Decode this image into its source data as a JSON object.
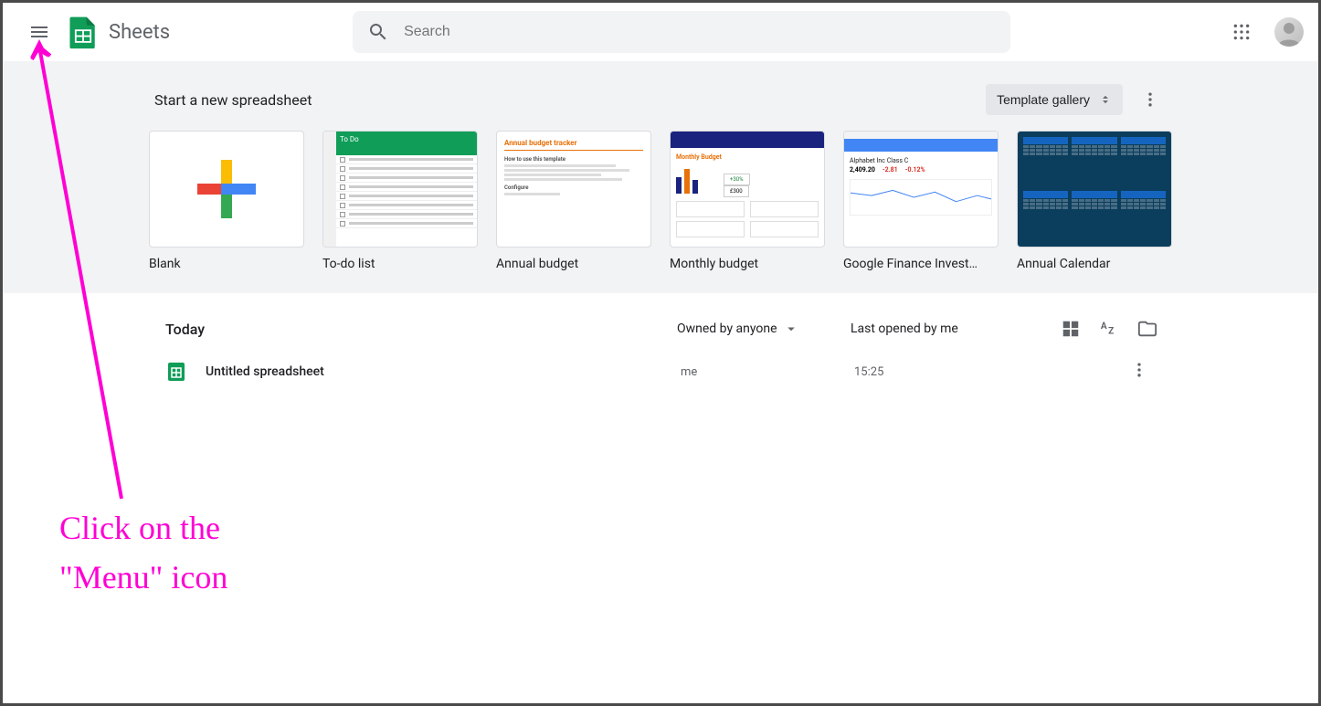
{
  "header": {
    "app_title": "Sheets",
    "search_placeholder": "Search"
  },
  "templates": {
    "section_title": "Start a new spreadsheet",
    "gallery_button": "Template gallery",
    "items": [
      {
        "label": "Blank"
      },
      {
        "label": "To-do list"
      },
      {
        "label": "Annual budget"
      },
      {
        "label": "Monthly budget"
      },
      {
        "label": "Google Finance Invest…"
      },
      {
        "label": "Annual Calendar"
      }
    ],
    "thumb_todo_header": "To Do",
    "thumb_annual_title": "Annual budget tracker",
    "thumb_annual_sub1": "How to use this template",
    "thumb_annual_sub2": "Configure",
    "thumb_monthly_title": "Monthly Budget",
    "thumb_monthly_stat_pct": "+30%",
    "thumb_monthly_stat_val": "£300",
    "thumb_finance_name": "Alphabet Inc Class C",
    "thumb_finance_price": "2,409.20",
    "thumb_finance_change1": "-2.81",
    "thumb_finance_change2": "-0.12%"
  },
  "files": {
    "section_title": "Today",
    "owner_filter": "Owned by anyone",
    "sort_label": "Last opened by me",
    "rows": [
      {
        "name": "Untitled spreadsheet",
        "owner": "me",
        "time": "15:25"
      }
    ]
  },
  "annotation": {
    "text": "Click on the\n\"Menu\" icon"
  },
  "colors": {
    "accent_green": "#0f9d58",
    "annotation_pink": "#ff00d4"
  }
}
